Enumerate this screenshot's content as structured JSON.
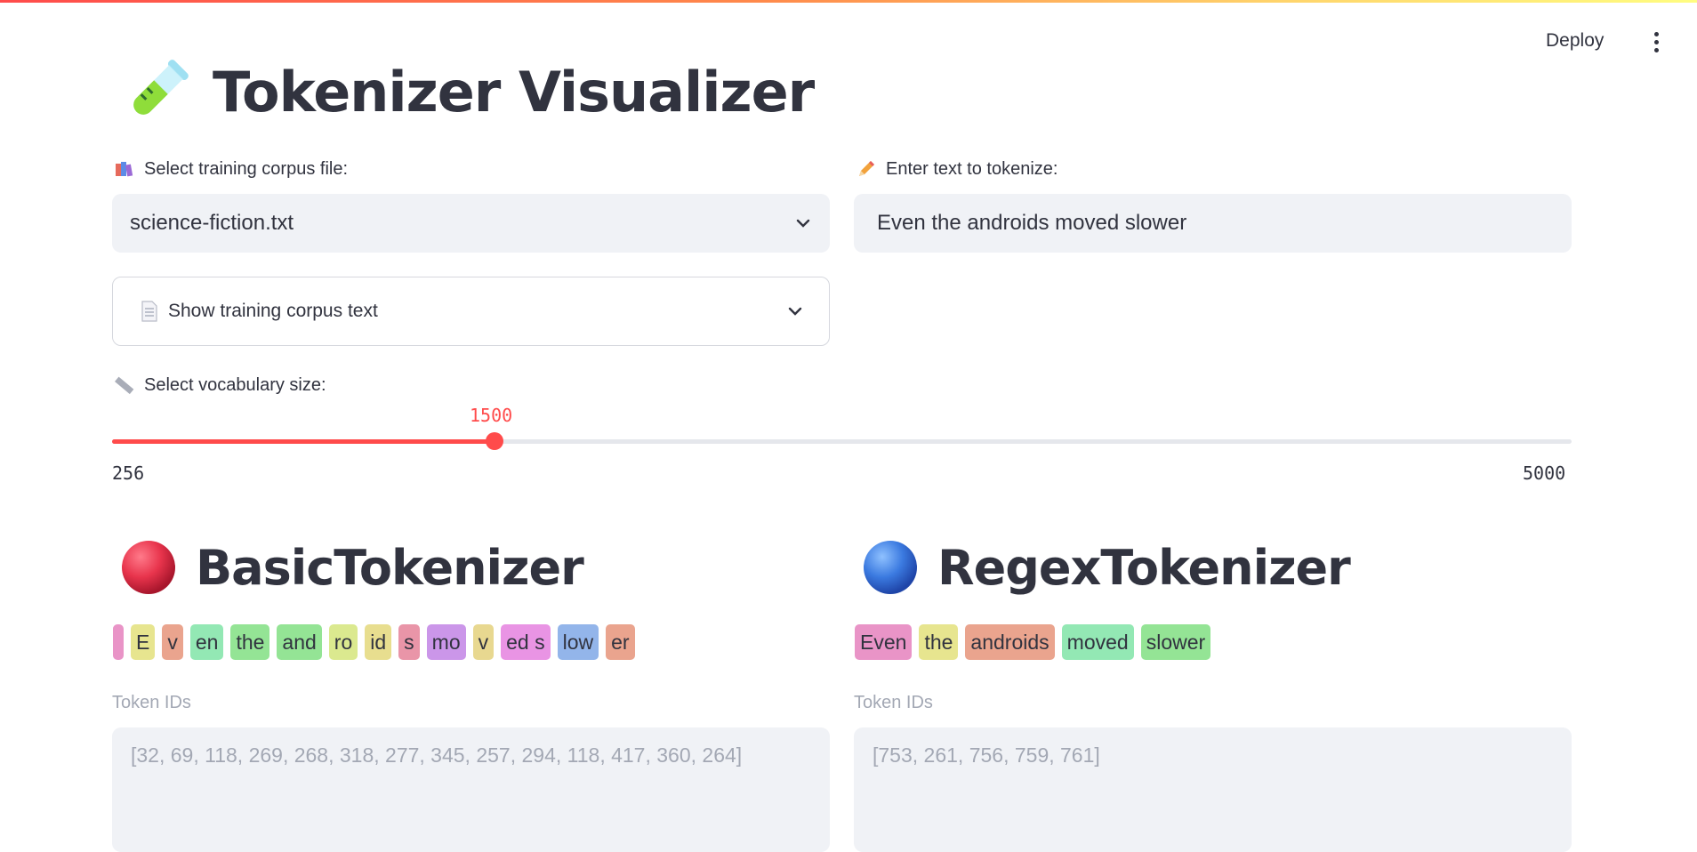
{
  "header": {
    "deploy_label": "Deploy",
    "menu_icon": "kebab-menu-icon"
  },
  "title": {
    "icon": "test-tube-icon",
    "text": "Tokenizer Visualizer"
  },
  "corpus": {
    "label": "Select training corpus file:",
    "icon": "books-icon",
    "selected": "science-fiction.txt"
  },
  "text_input": {
    "label": "Enter text to tokenize:",
    "icon": "pencil-icon",
    "value": "Even the androids moved slower"
  },
  "expander": {
    "icon": "document-icon",
    "label": "Show training corpus text"
  },
  "vocab": {
    "label": "Select vocabulary size:",
    "icon": "ruler-icon",
    "value": "1500",
    "min": "256",
    "max": "5000",
    "fraction": 0.2622
  },
  "basic": {
    "icon": "red-ball-icon",
    "title": "BasicTokenizer",
    "tokens": [
      {
        "text": " ",
        "color": "#e994c7"
      },
      {
        "text": "E",
        "color": "#e7e58f"
      },
      {
        "text": "v",
        "color": "#eaa48e"
      },
      {
        "text": "en",
        "color": "#93e8b4"
      },
      {
        "text": "the",
        "color": "#94e495"
      },
      {
        "text": "and",
        "color": "#94e495"
      },
      {
        "text": "ro",
        "color": "#dbe98f"
      },
      {
        "text": "id",
        "color": "#e8de8f"
      },
      {
        "text": "s",
        "color": "#e995a8"
      },
      {
        "text": "mo",
        "color": "#cb96e9"
      },
      {
        "text": "v",
        "color": "#e8d890"
      },
      {
        "text": "ed s",
        "color": "#e994e4"
      },
      {
        "text": "low",
        "color": "#93b5ea"
      },
      {
        "text": "er",
        "color": "#eaa48e"
      }
    ],
    "ids_label": "Token IDs",
    "ids": "[32, 69, 118, 269, 268, 318, 277, 345, 257, 294, 118, 417, 360, 264]"
  },
  "regex": {
    "icon": "blue-ball-icon",
    "title": "RegexTokenizer",
    "tokens": [
      {
        "text": "Even",
        "color": "#e994c7"
      },
      {
        "text": "the",
        "color": "#e7e58f"
      },
      {
        "text": "androids",
        "color": "#eaa48e"
      },
      {
        "text": "moved",
        "color": "#93e8b4"
      },
      {
        "text": "slower",
        "color": "#94e495"
      }
    ],
    "ids_label": "Token IDs",
    "ids": "[753, 261, 756, 759, 761]"
  },
  "colors": {
    "accent": "#ff4b4b",
    "input_bg": "#f0f2f6",
    "text": "#31333f",
    "muted": "#a3a8b4"
  }
}
